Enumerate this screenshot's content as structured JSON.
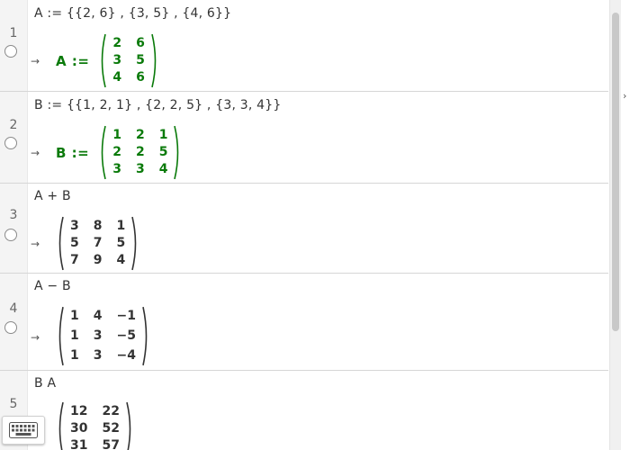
{
  "rows": [
    {
      "number": "1",
      "input": "A := {{2, 6} , {3, 5} , {4, 6}}",
      "arrow": "→",
      "label": "A :=",
      "style": "green",
      "matrix": [
        [
          "2",
          "6"
        ],
        [
          "3",
          "5"
        ],
        [
          "4",
          "6"
        ]
      ]
    },
    {
      "number": "2",
      "input": "B := {{1, 2, 1} , {2, 2, 5} , {3, 3, 4}}",
      "arrow": "→",
      "label": "B :=",
      "style": "green",
      "matrix": [
        [
          "1",
          "2",
          "1"
        ],
        [
          "2",
          "2",
          "5"
        ],
        [
          "3",
          "3",
          "4"
        ]
      ]
    },
    {
      "number": "3",
      "input": "A + B",
      "arrow": "→",
      "label": "",
      "style": "black",
      "matrix": [
        [
          "3",
          "8",
          "1"
        ],
        [
          "5",
          "7",
          "5"
        ],
        [
          "7",
          "9",
          "4"
        ]
      ]
    },
    {
      "number": "4",
      "input": "A − B",
      "arrow": "→",
      "label": "",
      "style": "black",
      "matrix": [
        [
          "1",
          "4",
          "−1"
        ],
        [
          "1",
          "3",
          "−5"
        ],
        [
          "1",
          "3",
          "−4"
        ]
      ]
    },
    {
      "number": "5",
      "input": "B A",
      "arrow": "→",
      "label": "",
      "style": "black",
      "matrix": [
        [
          "12",
          "22"
        ],
        [
          "30",
          "52"
        ],
        [
          "31",
          "57"
        ]
      ]
    }
  ],
  "icons": {
    "keyboard": "keyboard-icon",
    "radio": "radio-circle-icon",
    "arrow": "arrow-right-icon"
  },
  "colors": {
    "green_output": "#0a7a0a",
    "gutter": "#f4f4f4",
    "divider": "#d6d6d6"
  }
}
